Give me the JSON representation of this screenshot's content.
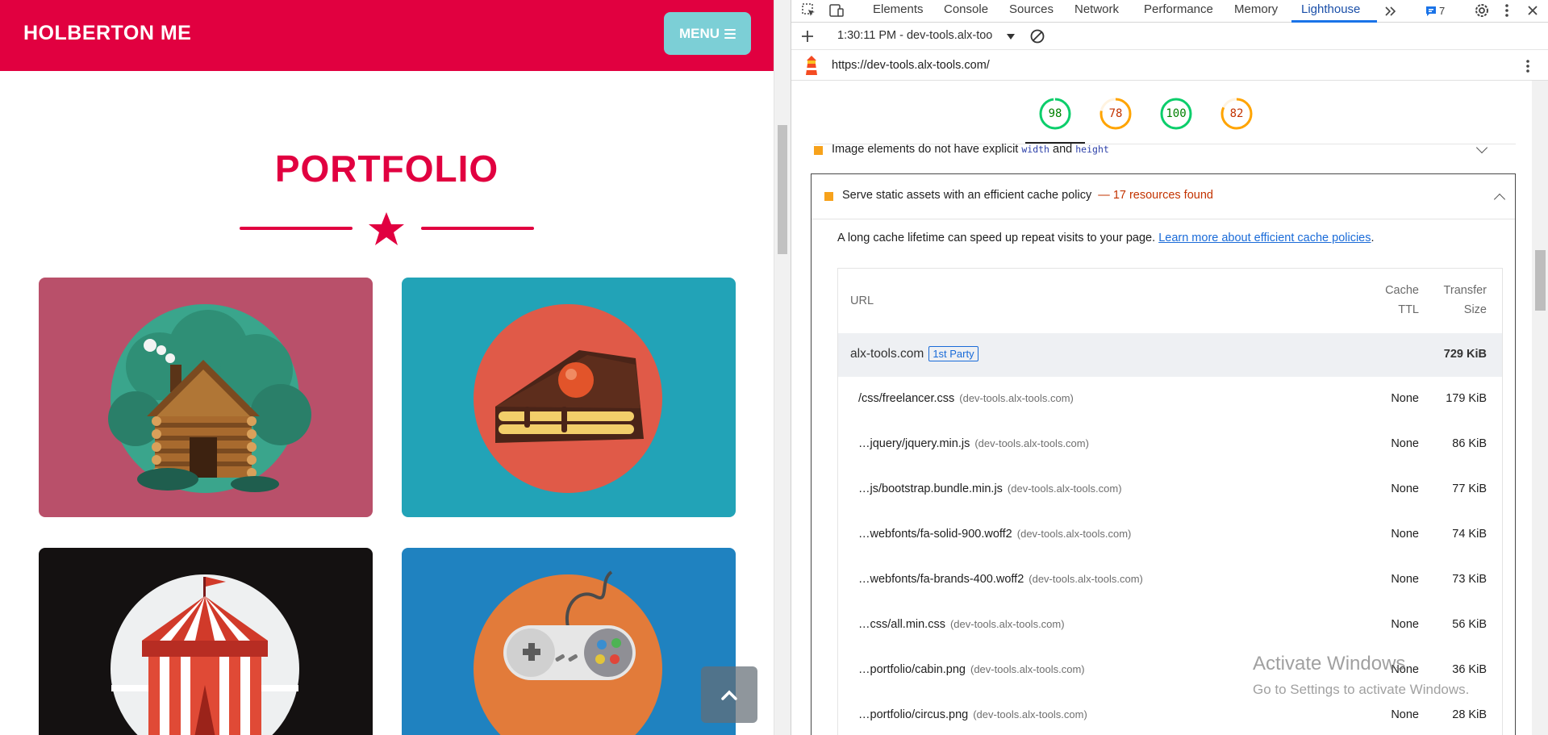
{
  "site": {
    "brand": "HOLBERTON ME",
    "menu_label": "MENU",
    "portfolio_title": "PORTFOLIO",
    "colors": {
      "primary": "#e10040",
      "menu": "#7ccfd6"
    },
    "cards": [
      {
        "name": "cabin",
        "bg": "#b9506a"
      },
      {
        "name": "cake",
        "bg": "#22a3b7"
      },
      {
        "name": "circus",
        "bg": "#141111"
      },
      {
        "name": "game",
        "bg": "#1f82c0"
      }
    ]
  },
  "devtools": {
    "tabs": [
      "Elements",
      "Console",
      "Sources",
      "Network",
      "Performance",
      "Memory",
      "Lighthouse"
    ],
    "active_tab": "Lighthouse",
    "issues_count": "7",
    "run_label": "1:30:11 PM - dev-tools.alx-too",
    "report_url": "https://dev-tools.alx-tools.com/",
    "scores": [
      {
        "value": "98",
        "color": "#0cce6b",
        "text": "#008000",
        "fraction": 0.98
      },
      {
        "value": "78",
        "color": "#ffa400",
        "text": "#c33300",
        "fraction": 0.78
      },
      {
        "value": "100",
        "color": "#0cce6b",
        "text": "#008000",
        "fraction": 1.0
      },
      {
        "value": "82",
        "color": "#ffa400",
        "text": "#c33300",
        "fraction": 0.82
      }
    ],
    "audit_collapsed": {
      "title": "Image elements do not have explicit",
      "code1": "width",
      "and": "and",
      "code2": "height"
    },
    "audit_expanded": {
      "title": "Serve static assets with an efficient cache policy",
      "dash": "—",
      "summary": "17 resources found",
      "description": "A long cache lifetime can speed up repeat visits to your page.",
      "learn_more": "Learn more about efficient cache policies",
      "period": ".",
      "table": {
        "col_url": "URL",
        "col_ttl_1": "Cache",
        "col_ttl_2": "TTL",
        "col_size_1": "Transfer",
        "col_size_2": "Size",
        "group": {
          "host": "alx-tools.com",
          "badge": "1st Party",
          "size": "729 KiB"
        },
        "rows": [
          {
            "path": "/css/freelancer.css",
            "host": "(dev-tools.alx-tools.com)",
            "ttl": "None",
            "size": "179 KiB"
          },
          {
            "path": "…jquery/jquery.min.js",
            "host": "(dev-tools.alx-tools.com)",
            "ttl": "None",
            "size": "86 KiB"
          },
          {
            "path": "…js/bootstrap.bundle.min.js",
            "host": "(dev-tools.alx-tools.com)",
            "ttl": "None",
            "size": "77 KiB"
          },
          {
            "path": "…webfonts/fa-solid-900.woff2",
            "host": "(dev-tools.alx-tools.com)",
            "ttl": "None",
            "size": "74 KiB"
          },
          {
            "path": "…webfonts/fa-brands-400.woff2",
            "host": "(dev-tools.alx-tools.com)",
            "ttl": "None",
            "size": "73 KiB"
          },
          {
            "path": "…css/all.min.css",
            "host": "(dev-tools.alx-tools.com)",
            "ttl": "None",
            "size": "56 KiB"
          },
          {
            "path": "…portfolio/cabin.png",
            "host": "(dev-tools.alx-tools.com)",
            "ttl": "None",
            "size": "36 KiB"
          },
          {
            "path": "…portfolio/circus.png",
            "host": "(dev-tools.alx-tools.com)",
            "ttl": "None",
            "size": "28 KiB"
          }
        ]
      }
    }
  },
  "watermark": {
    "line1": "Activate Windows",
    "line2": "Go to Settings to activate Windows."
  }
}
